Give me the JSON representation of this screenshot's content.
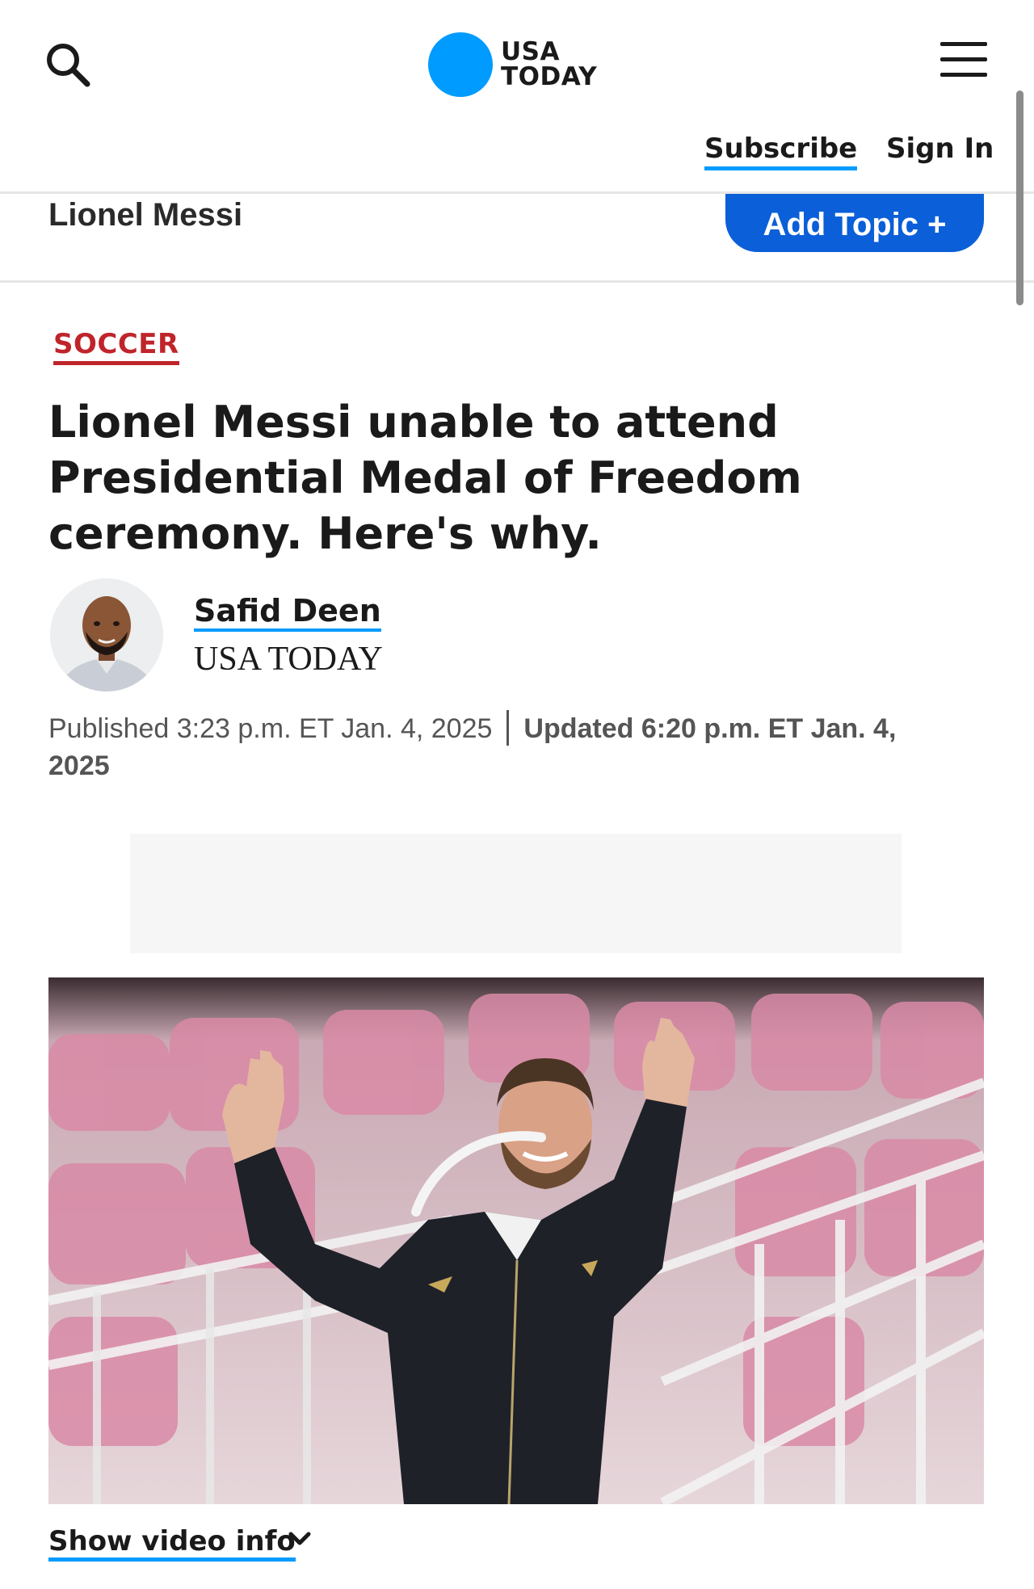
{
  "header": {
    "logo_line1": "USA",
    "logo_line2": "TODAY",
    "subscribe_label": "Subscribe",
    "signin_label": "Sign In",
    "brand_color": "#009bff"
  },
  "topic_bar": {
    "topic": "Lionel Messi",
    "add_topic_label": "Add Topic +",
    "button_color": "#0b5fd8"
  },
  "article": {
    "section": "SOCCER",
    "section_color": "#c0242b",
    "headline": "Lionel Messi unable to attend Presidential Medal of Freedom ceremony. Here's why.",
    "author": {
      "name": "Safid Deen",
      "organization": "USA TODAY"
    },
    "published": "Published 3:23 p.m. ET Jan. 4, 2025",
    "updated": "Updated 6:20 p.m. ET Jan. 4, 2025"
  },
  "video": {
    "show_info_label": "Show video info",
    "icons": [
      "loading-spinner-icon",
      "chevron-down-icon"
    ]
  }
}
